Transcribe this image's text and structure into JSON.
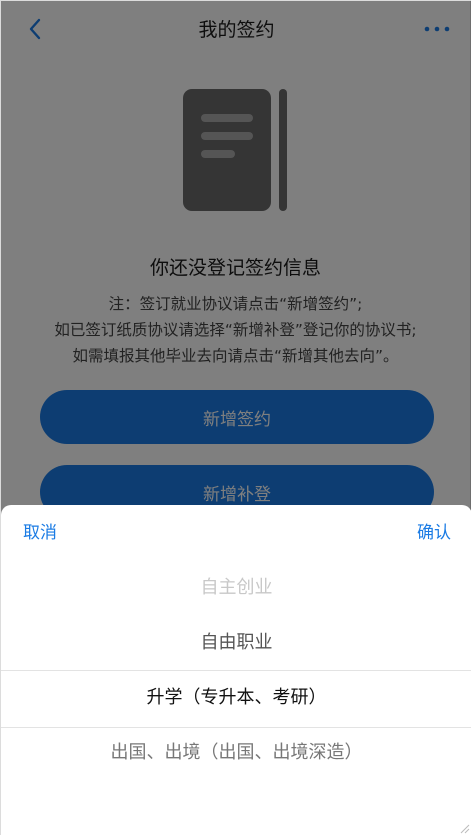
{
  "header": {
    "title": "我的签约",
    "back_icon": "chevron-left-icon",
    "more_icon": "more-horizontal-icon"
  },
  "empty_state": {
    "illustration": "document-icon",
    "title": "你还没登记签约信息",
    "notes": [
      "注：签订就业协议请点击“新增签约”;",
      "如已签订纸质协议请选择“新增补登”登记你的协议书;",
      "如需填报其他毕业去向请点击“新增其他去向”。"
    ]
  },
  "buttons": {
    "add_sign": "新增签约",
    "add_supplement": "新增补登"
  },
  "picker": {
    "cancel": "取消",
    "confirm": "确认",
    "options": [
      "自主创业",
      "自由职业",
      "升学（专升本、考研）",
      "出国、出境（出国、出境深造）"
    ],
    "selected": "升学（专升本、考研）"
  },
  "colors": {
    "accent": "#1a7be4",
    "overlay": "rgba(0,0,0,0.5)"
  }
}
